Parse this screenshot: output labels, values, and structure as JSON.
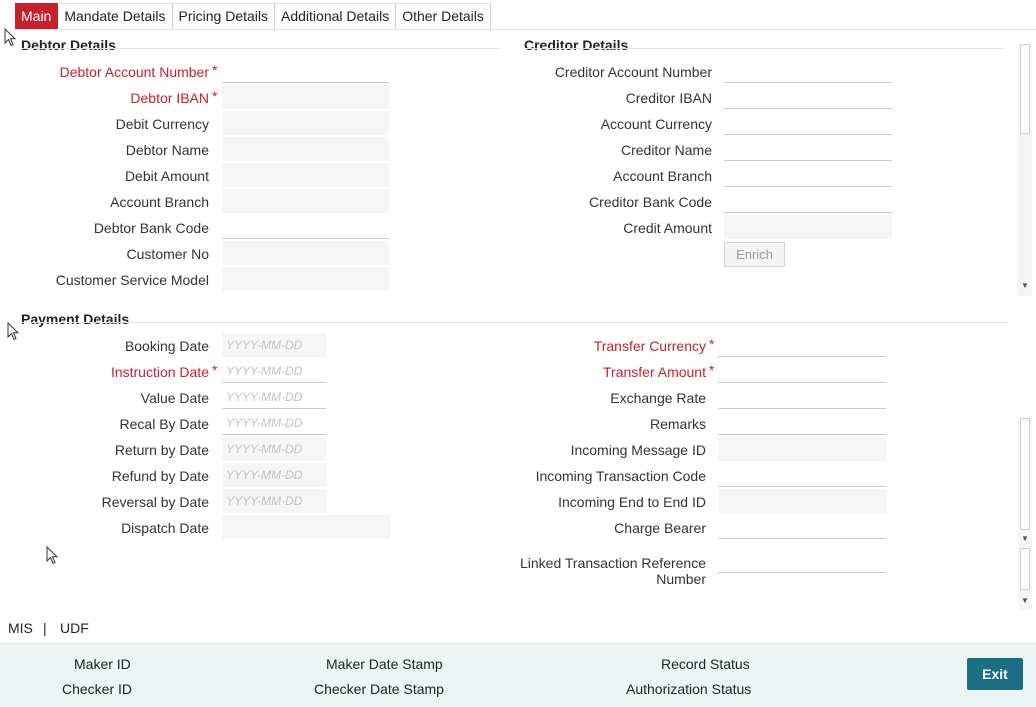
{
  "tabs": [
    "Main",
    "Mandate Details",
    "Pricing Details",
    "Additional Details",
    "Other Details"
  ],
  "debtor": {
    "title": "Debtor Details",
    "fields": [
      {
        "label": "Debtor Account Number",
        "required": true
      },
      {
        "label": "Debtor IBAN",
        "required": true
      },
      {
        "label": "Debit Currency"
      },
      {
        "label": "Debtor Name"
      },
      {
        "label": "Debit Amount"
      },
      {
        "label": "Account Branch"
      },
      {
        "label": "Debtor Bank Code"
      },
      {
        "label": "Customer No"
      },
      {
        "label": "Customer Service Model"
      }
    ]
  },
  "creditor": {
    "title": "Creditor Details",
    "fields": [
      {
        "label": "Creditor Account Number"
      },
      {
        "label": "Creditor IBAN"
      },
      {
        "label": "Account Currency"
      },
      {
        "label": "Creditor Name"
      },
      {
        "label": "Account Branch"
      },
      {
        "label": "Creditor Bank Code"
      },
      {
        "label": "Credit Amount"
      }
    ],
    "enrich_label": "Enrich"
  },
  "payment": {
    "title": "Payment Details",
    "date_placeholder": "YYYY-MM-DD",
    "left_fields": [
      {
        "label": "Booking Date"
      },
      {
        "label": "Instruction Date",
        "required": true
      },
      {
        "label": "Value Date"
      },
      {
        "label": "Recal By Date"
      },
      {
        "label": "Return by Date"
      },
      {
        "label": "Refund by Date"
      },
      {
        "label": "Reversal by Date"
      },
      {
        "label": "Dispatch Date"
      }
    ],
    "right_fields": [
      {
        "label": "Transfer Currency",
        "required": true
      },
      {
        "label": "Transfer Amount",
        "required": true
      },
      {
        "label": "Exchange Rate"
      },
      {
        "label": "Remarks"
      },
      {
        "label": "Incoming Message ID"
      },
      {
        "label": "Incoming Transaction Code"
      },
      {
        "label": "Incoming End to End ID"
      },
      {
        "label": "Charge Bearer"
      }
    ],
    "linked_label_1": "Linked Transaction Reference",
    "linked_label_2": "Number"
  },
  "links": {
    "mis": "MIS",
    "sep": "|",
    "udf": "UDF"
  },
  "footer": {
    "maker_id": "Maker ID",
    "checker_id": "Checker ID",
    "maker_date": "Maker Date Stamp",
    "checker_date": "Checker Date Stamp",
    "record_status": "Record Status",
    "auth_status": "Authorization Status",
    "exit": "Exit"
  },
  "theme": {
    "accent": "#c7202d",
    "button": "#1b6f82",
    "footer_bg": "#edf4f4"
  }
}
